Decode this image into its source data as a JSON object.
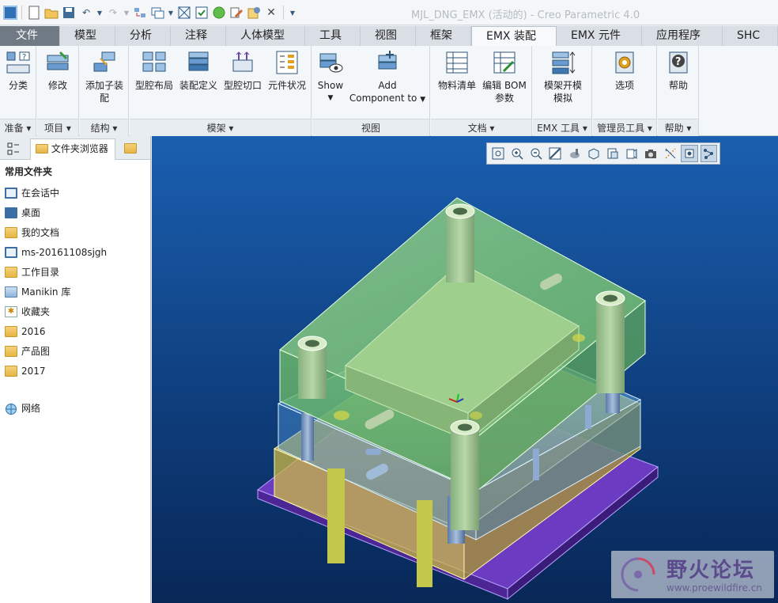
{
  "window": {
    "title": "MJL_DNG_EMX (活动的) - Creo Parametric 4.0"
  },
  "quick_access": {
    "icons": [
      "new-icon",
      "open-icon",
      "save-icon",
      "undo-icon",
      "redo-icon",
      "regenerate-icon",
      "windows-icon",
      "close-icon"
    ]
  },
  "tabs": [
    {
      "label": "文件"
    },
    {
      "label": "模型"
    },
    {
      "label": "分析"
    },
    {
      "label": "注释"
    },
    {
      "label": "人体模型"
    },
    {
      "label": "工具"
    },
    {
      "label": "视图"
    },
    {
      "label": "框架"
    },
    {
      "label": "EMX 装配"
    },
    {
      "label": "EMX 元件"
    },
    {
      "label": "应用程序"
    },
    {
      "label": "SHC"
    }
  ],
  "ribbon": {
    "groups": {
      "prepare": "准备",
      "project": "项目",
      "structure": "结构",
      "moldbase": "模架",
      "view": "视图",
      "document": "文档",
      "emx_tools": "EMX 工具",
      "admin_tools": "管理员工具",
      "help": "帮助"
    },
    "buttons": {
      "classify": "分类",
      "modify": "修改",
      "add_sub_line1": "添加子装",
      "add_sub_line2": "配",
      "cavity_layout": "型腔布局",
      "assembly_def": "装配定义",
      "cavity_cut": "型腔切口",
      "component_status": "元件状况",
      "show": "Show",
      "add_component_line1": "Add",
      "add_component_line2": "Component to",
      "bom": "物料清单",
      "edit_bom_line1": "编辑 BOM",
      "edit_bom_line2": "参数",
      "mold_open_line1": "模架开模",
      "mold_open_line2": "模拟",
      "options": "选项",
      "help": "帮助"
    }
  },
  "browser": {
    "tab_label": "文件夹浏览器",
    "section": "常用文件夹",
    "items": [
      {
        "label": "在会话中",
        "icon": "monitor-icon"
      },
      {
        "label": "桌面",
        "icon": "desktop-icon"
      },
      {
        "label": "我的文档",
        "icon": "documents-icon"
      },
      {
        "label": "ms-20161108sjgh",
        "icon": "computer-icon"
      },
      {
        "label": "工作目录",
        "icon": "working-dir-icon"
      },
      {
        "label": "Manikin 库",
        "icon": "library-icon"
      },
      {
        "label": "收藏夹",
        "icon": "favorites-icon"
      },
      {
        "label": "2016",
        "icon": "folder-icon"
      },
      {
        "label": "产品图",
        "icon": "folder-icon"
      },
      {
        "label": "2017",
        "icon": "folder-icon"
      }
    ],
    "network": "网络"
  },
  "watermark": {
    "title": "野火论坛",
    "url": "www.proewildfire.cn"
  },
  "colors": {
    "viewport_top": "#1a5fb0",
    "viewport_bottom": "#082757",
    "plate_green": "#7dc47a",
    "plate_blue": "#5aa7e0",
    "plate_yellow": "#d9c84b",
    "base_purple": "#6b3cc2"
  }
}
